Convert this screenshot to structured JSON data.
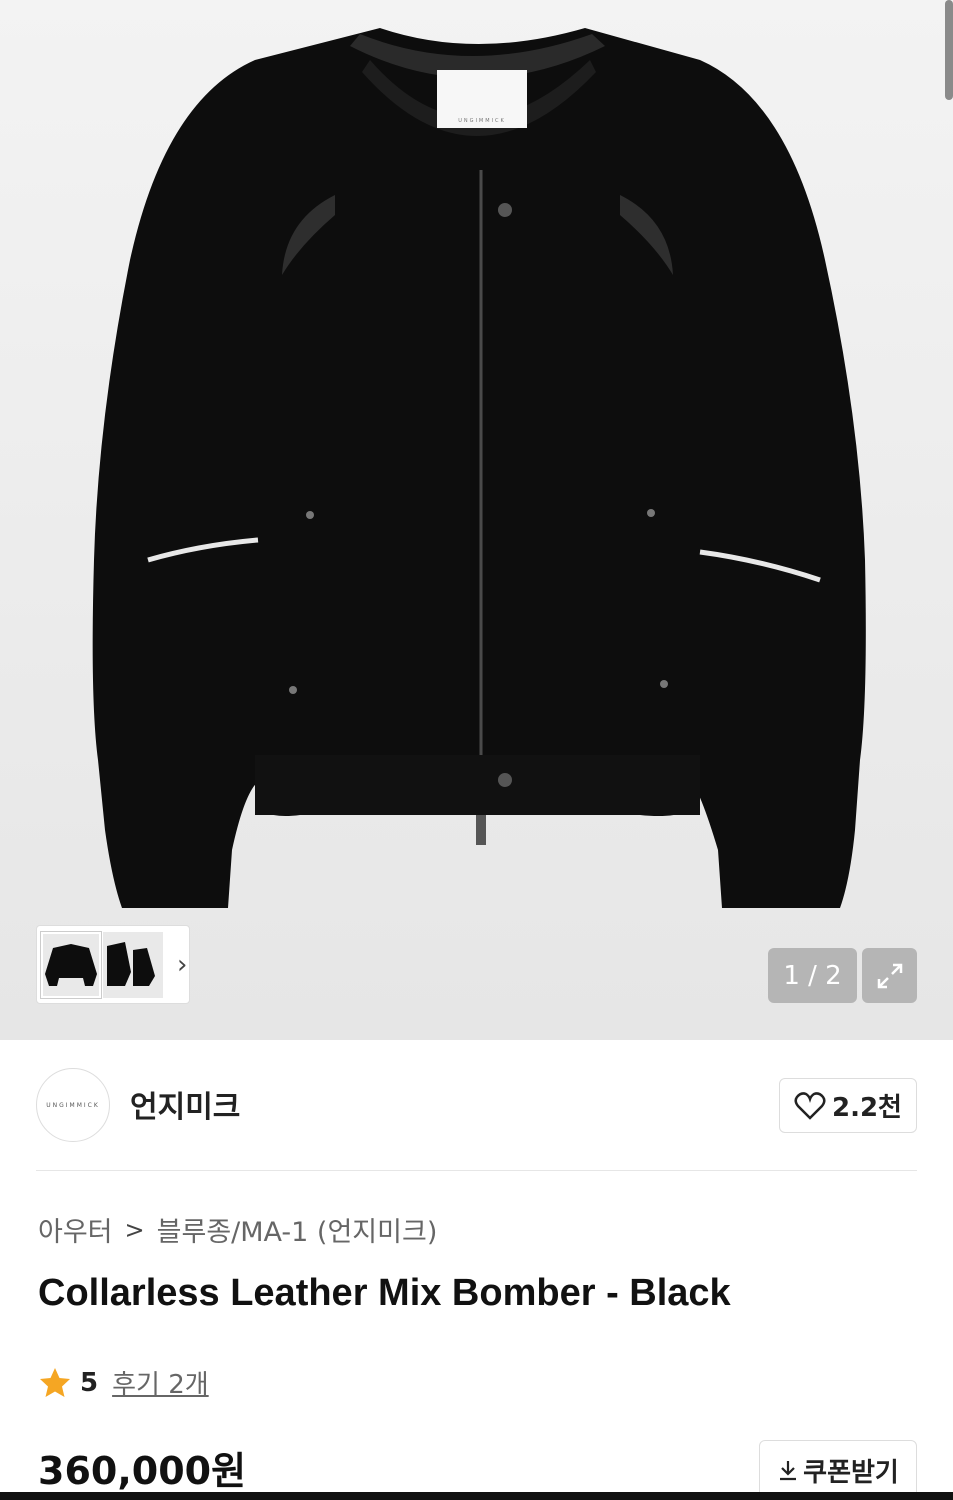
{
  "gallery": {
    "counter": "1 / 2",
    "thumbnails": [
      "jacket-front",
      "jacket-side"
    ]
  },
  "brand": {
    "name": "언지미크",
    "logo_text": "UNGIMMICK",
    "likes": "2.2천"
  },
  "breadcrumb": {
    "category": "아우터",
    "subcategory": "블루종/MA-1 (언지미크)"
  },
  "product": {
    "title": "Collarless Leather Mix Bomber - Black",
    "rating": "5",
    "reviews": "후기 2개",
    "price": "360,000원"
  },
  "coupon": {
    "label": "쿠폰받기"
  },
  "colors": {
    "star": "#f5a623",
    "garment": "#0d0d0d"
  }
}
